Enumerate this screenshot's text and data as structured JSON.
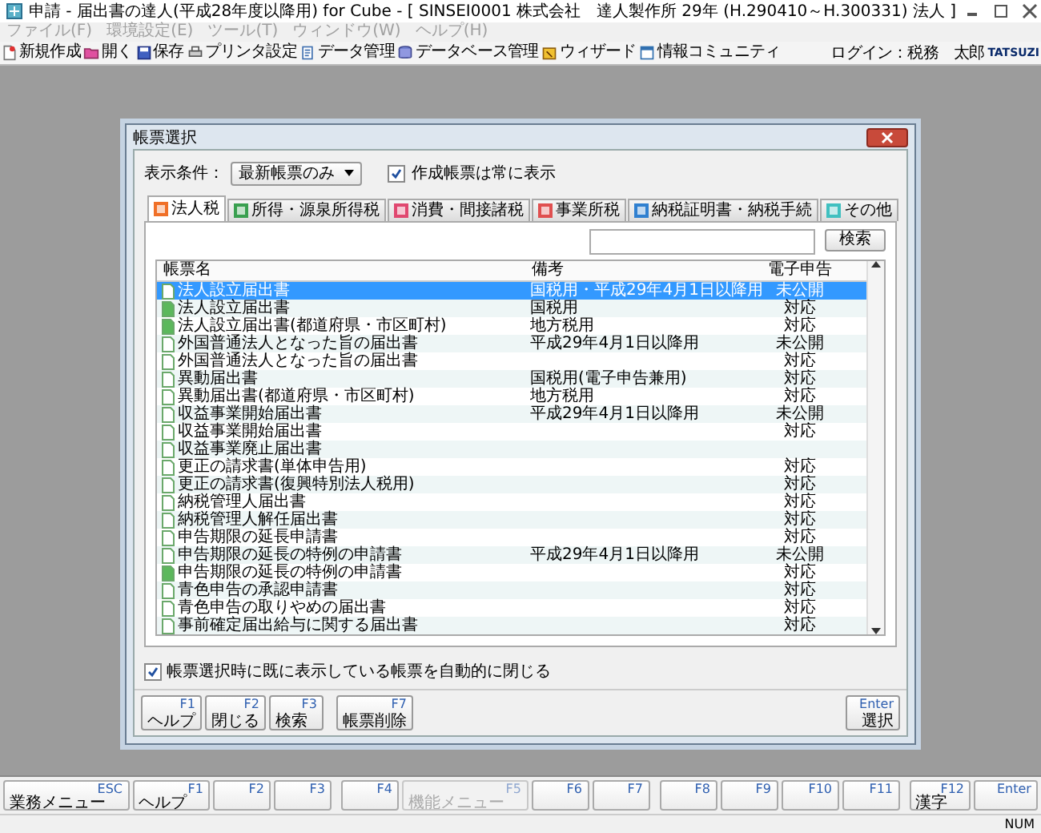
{
  "window": {
    "title": "申請 - 届出書の達人(平成28年度以降用) for Cube - [ SINSEI0001 株式会社　達人製作所 29年 (H.290410～H.300331) 法人 ]"
  },
  "menu": [
    {
      "label": "ファイル(F)",
      "disabled": true
    },
    {
      "label": "環境設定(E)",
      "disabled": true
    },
    {
      "label": "ツール(T)",
      "disabled": true
    },
    {
      "label": "ウィンドウ(W)",
      "disabled": true
    },
    {
      "label": "ヘルプ(H)",
      "disabled": true
    }
  ],
  "toolbar": {
    "items": [
      {
        "label": "新規作成"
      },
      {
        "label": "開く"
      },
      {
        "label": "保存"
      },
      {
        "label": "プリンタ設定"
      },
      {
        "label": "データ管理"
      },
      {
        "label": "データベース管理"
      },
      {
        "label": "ウィザード"
      },
      {
        "label": "情報コミュニティ"
      }
    ],
    "login": "ログイン：税務　太郎",
    "logo": "TATSUZI"
  },
  "dialog": {
    "title": "帳票選択",
    "filter": {
      "label": "表示条件：",
      "value": "最新帳票のみ"
    },
    "show_created": {
      "label": "作成帳票は常に表示",
      "checked": true
    },
    "tabs": [
      {
        "label": "法人税",
        "selected": true,
        "color": "#f07028"
      },
      {
        "label": "所得・源泉所得税",
        "selected": false,
        "color": "#3aa050"
      },
      {
        "label": "消費・間接諸税",
        "selected": false,
        "color": "#e04870"
      },
      {
        "label": "事業所税",
        "selected": false,
        "color": "#e05050"
      },
      {
        "label": "納税証明書・納税手続",
        "selected": false,
        "color": "#3080d0"
      },
      {
        "label": "その他",
        "selected": false,
        "color": "#40c0c0"
      }
    ],
    "search": {
      "button": "検索"
    },
    "table": {
      "columns": [
        "帳票名",
        "備考",
        "電子申告"
      ],
      "rows": [
        {
          "kind": "blank",
          "name": "法人設立届出書",
          "note": "国税用・平成29年4月1日以降用",
          "efile": "未公開",
          "selected": true
        },
        {
          "kind": "filled",
          "name": "法人設立届出書",
          "note": "国税用",
          "efile": "対応",
          "selected": false
        },
        {
          "kind": "filled",
          "name": "法人設立届出書(都道府県・市区町村)",
          "note": "地方税用",
          "efile": "対応",
          "selected": false
        },
        {
          "kind": "blank",
          "name": "外国普通法人となった旨の届出書",
          "note": "平成29年4月1日以降用",
          "efile": "未公開",
          "selected": false
        },
        {
          "kind": "blank",
          "name": "外国普通法人となった旨の届出書",
          "efile": "対応",
          "selected": false
        },
        {
          "kind": "blank",
          "name": "異動届出書",
          "note": "国税用(電子申告兼用)",
          "efile": "対応",
          "selected": false
        },
        {
          "kind": "blank",
          "name": "異動届出書(都道府県・市区町村)",
          "note": "地方税用",
          "efile": "対応",
          "selected": false
        },
        {
          "kind": "blank",
          "name": "収益事業開始届出書",
          "note": "平成29年4月1日以降用",
          "efile": "未公開",
          "selected": false
        },
        {
          "kind": "blank",
          "name": "収益事業開始届出書",
          "efile": "対応",
          "selected": false
        },
        {
          "kind": "blank",
          "name": "収益事業廃止届出書",
          "selected": false
        },
        {
          "kind": "blank",
          "name": "更正の請求書(単体申告用)",
          "efile": "対応",
          "selected": false
        },
        {
          "kind": "blank",
          "name": "更正の請求書(復興特別法人税用)",
          "efile": "対応",
          "selected": false
        },
        {
          "kind": "blank",
          "name": "納税管理人届出書",
          "efile": "対応",
          "selected": false
        },
        {
          "kind": "blank",
          "name": "納税管理人解任届出書",
          "efile": "対応",
          "selected": false
        },
        {
          "kind": "blank",
          "name": "申告期限の延長申請書",
          "efile": "対応",
          "selected": false
        },
        {
          "kind": "blank",
          "name": "申告期限の延長の特例の申請書",
          "note": "平成29年4月1日以降用",
          "efile": "未公開",
          "selected": false
        },
        {
          "kind": "filled",
          "name": "申告期限の延長の特例の申請書",
          "efile": "対応",
          "selected": false
        },
        {
          "kind": "blank",
          "name": "青色申告の承認申請書",
          "efile": "対応",
          "selected": false
        },
        {
          "kind": "blank",
          "name": "青色申告の取りやめの届出書",
          "efile": "対応",
          "selected": false
        },
        {
          "kind": "blank",
          "name": "事前確定届出給与に関する届出書",
          "efile": "対応",
          "selected": false
        }
      ]
    },
    "auto_close": {
      "label": "帳票選択時に既に表示している帳票を自動的に閉じる",
      "checked": true
    },
    "buttons": [
      {
        "kind": "action",
        "key": "F1",
        "label": "ヘルプ"
      },
      {
        "kind": "action",
        "key": "F2",
        "label": "閉じる"
      },
      {
        "kind": "action",
        "key": "F3",
        "label": "検索"
      },
      {
        "kind": "gap"
      },
      {
        "kind": "action",
        "key": "F7",
        "label": "帳票削除"
      },
      {
        "kind": "confirm",
        "key": "Enter",
        "label": "選択"
      }
    ]
  },
  "function_keys": [
    {
      "key": "ESC",
      "label": "業務メニュー",
      "disabled": false
    },
    {
      "key": "F1",
      "label": "ヘルプ",
      "disabled": false
    },
    {
      "key": "F2",
      "disabled": false
    },
    {
      "key": "F3",
      "disabled": false
    },
    {
      "key": "F4",
      "disabled": false
    },
    {
      "key": "F5",
      "label": "機能メニュー",
      "disabled": true
    },
    {
      "key": "F6",
      "disabled": false
    },
    {
      "key": "F7",
      "disabled": false
    },
    {
      "key": "F8",
      "disabled": false
    },
    {
      "key": "F9",
      "disabled": false
    },
    {
      "key": "F10",
      "disabled": false
    },
    {
      "key": "F11",
      "disabled": false
    },
    {
      "key": "F12",
      "label": "漢字",
      "disabled": false
    },
    {
      "key": "Enter",
      "disabled": false
    }
  ],
  "status_bar": {
    "indicator": "NUM"
  }
}
